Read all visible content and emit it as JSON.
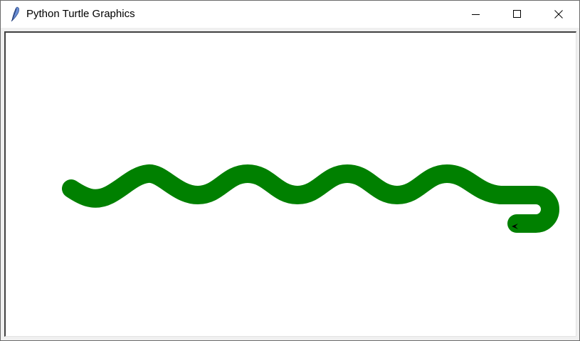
{
  "window": {
    "title": "Python Turtle Graphics",
    "icon": "feather-icon"
  },
  "titlebar_buttons": {
    "minimize": "minimize-icon",
    "maximize": "maximize-icon",
    "close": "close-icon"
  },
  "canvas": {
    "background": "#ffffff",
    "pen_color": "#008000",
    "turtle_color": "#000000",
    "drawing": "green sine-wave snake with hooked tail",
    "turtle_shape": "classic arrow pointing left"
  }
}
